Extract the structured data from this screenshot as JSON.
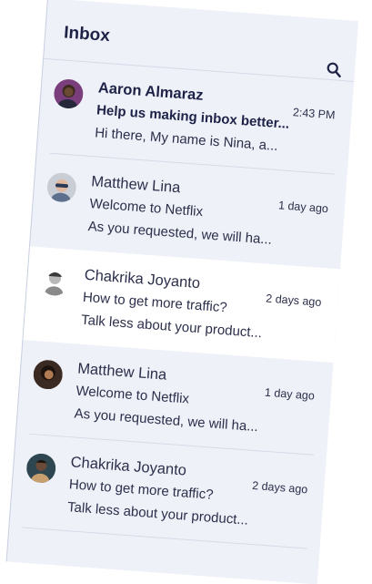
{
  "inbox": {
    "title": "Inbox",
    "search_icon": "search-icon",
    "messages": [
      {
        "sender": "Aaron Almaraz",
        "time": "2:43 PM",
        "subject": "Help us making inbox better...",
        "preview": "Hi there, My name is Nina, a...",
        "unread": true,
        "avatar_color": "#7a3e7d"
      },
      {
        "sender": "Matthew Lina",
        "time": "1 day ago",
        "subject": "Welcome to Netflix",
        "preview": "As you requested, we will ha...",
        "unread": false,
        "avatar_color": "#c9ced6"
      },
      {
        "sender": "Chakrika Joyanto",
        "time": "2 days ago",
        "subject": "How to get more traffic?",
        "preview": "Talk less about your product...",
        "unread": false,
        "avatar_color": "#e6e6e6"
      },
      {
        "sender": "Matthew Lina",
        "time": "1 day ago",
        "subject": "Welcome to Netflix",
        "preview": "As you requested, we will ha...",
        "unread": false,
        "avatar_color": "#3a2a22"
      },
      {
        "sender": "Chakrika Joyanto",
        "time": "2 days ago",
        "subject": "How to get more traffic?",
        "preview": "Talk less about your product...",
        "unread": false,
        "avatar_color": "#2e4650"
      }
    ]
  }
}
